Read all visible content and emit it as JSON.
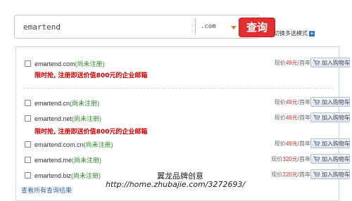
{
  "search": {
    "value": "emartend",
    "tld": ".com",
    "button_label": "查询"
  },
  "switch_mode": {
    "label": "切换多选模式",
    "icon": "plus-icon"
  },
  "promo_text": "限时抢, 注册即送价值800元的企业邮箱",
  "price_prefix": "现价",
  "price_suffix": "/首年",
  "cart_label": "加入购物车",
  "domains": [
    {
      "name": "emartend.com",
      "status": "(尚未注册)",
      "price": "49元"
    },
    {
      "name": "emartend.cn",
      "status": "(尚未注册)",
      "price": "49元"
    },
    {
      "name": "emartend.net",
      "status": "(尚未注册)",
      "price": "49元"
    },
    {
      "name": "emartend.com.cn",
      "status": "(尚未注册)",
      "price": "49元"
    },
    {
      "name": "emartend.me",
      "status": "(尚未注册)",
      "price": "320元"
    },
    {
      "name": "emartend.biz",
      "status": "(尚未注册)",
      "price": "220元"
    }
  ],
  "bottom_link": "查看所有查询结果",
  "watermark": {
    "line1": "翼龙品牌创意",
    "line2": "http://home.zhubajie.com/3272693/"
  },
  "colors": {
    "query_button": "#e03030",
    "status_green": "#2a8a2a",
    "promo_red": "#cc0000",
    "price_red": "#cc2a2a"
  }
}
